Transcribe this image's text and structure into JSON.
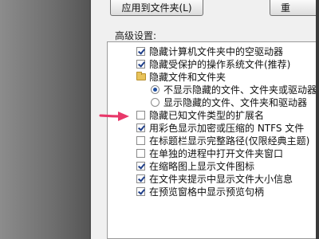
{
  "buttons": {
    "apply_to_folders": "应用到文件夹(L)",
    "restore": "重"
  },
  "advanced": {
    "label": "高级设置:",
    "items": [
      {
        "type": "checkbox",
        "checked": true,
        "label": "隐藏计算机文件夹中的空驱动器"
      },
      {
        "type": "checkbox",
        "checked": true,
        "label": "隐藏受保护的操作系统文件(推荐)"
      },
      {
        "type": "folder",
        "label": "隐藏文件和文件夹"
      },
      {
        "type": "radio",
        "checked": true,
        "label": "不显示隐藏的文件、文件夹或驱动器"
      },
      {
        "type": "radio",
        "checked": false,
        "label": "显示隐藏的文件、文件夹和驱动器"
      },
      {
        "type": "checkbox",
        "checked": false,
        "label": "隐藏已知文件类型的扩展名"
      },
      {
        "type": "checkbox",
        "checked": true,
        "label": "用彩色显示加密或压缩的 NTFS 文件"
      },
      {
        "type": "checkbox",
        "checked": false,
        "label": "在标题栏显示完整路径(仅限经典主题)"
      },
      {
        "type": "checkbox",
        "checked": false,
        "label": "在单独的进程中打开文件夹窗口"
      },
      {
        "type": "checkbox",
        "checked": true,
        "label": "在缩略图上显示文件图标"
      },
      {
        "type": "checkbox",
        "checked": true,
        "label": "在文件夹提示中显示文件大小信息"
      },
      {
        "type": "checkbox",
        "checked": true,
        "label": "在预览窗格中显示预览句柄"
      }
    ]
  },
  "colors": {
    "arrow": "#e8386a"
  }
}
